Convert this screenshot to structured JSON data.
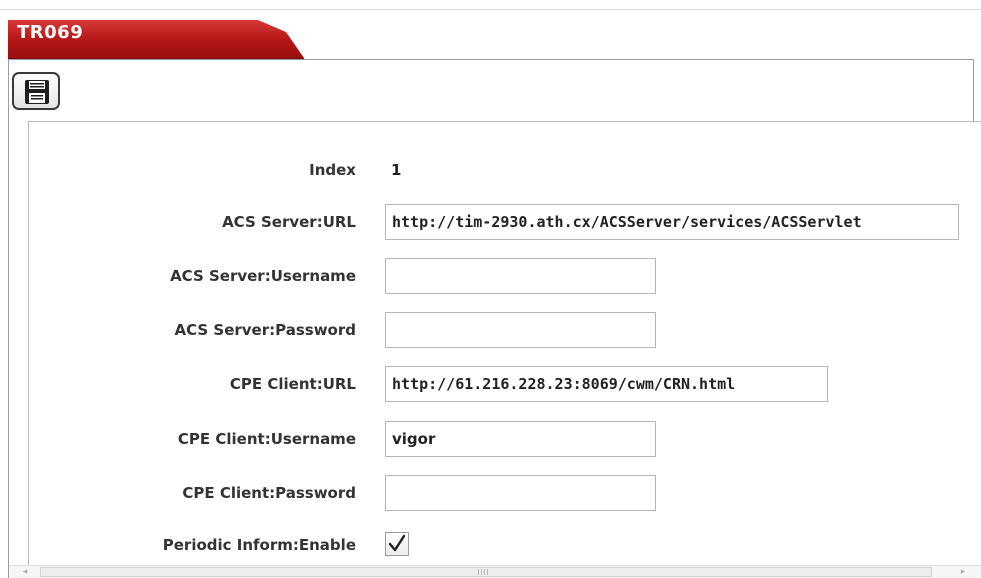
{
  "page": {
    "title": "TR069"
  },
  "toolbar": {
    "save_icon": "floppy-disk-icon"
  },
  "form": {
    "index": {
      "label": "Index",
      "value": "1"
    },
    "acs_url": {
      "label": "ACS Server:URL",
      "value": "http://tim-2930.ath.cx/ACSServer/services/ACSServlet"
    },
    "acs_username": {
      "label": "ACS Server:Username",
      "value": ""
    },
    "acs_password": {
      "label": "ACS Server:Password",
      "value": ""
    },
    "cpe_url": {
      "label": "CPE Client:URL",
      "value": "http://61.216.228.23:8069/cwm/CRN.html"
    },
    "cpe_username": {
      "label": "CPE Client:Username",
      "value": "vigor"
    },
    "cpe_password": {
      "label": "CPE Client:Password",
      "value": ""
    },
    "periodic_inform": {
      "label": "Periodic Inform:Enable",
      "checked": true,
      "icon": "checkmark-icon"
    }
  },
  "scrollbar": {
    "left_arrow": "◂",
    "right_arrow": "▸"
  },
  "colors": {
    "title_tab": "#b31515",
    "label_text": "#333333",
    "border": "#b5b5b5"
  }
}
